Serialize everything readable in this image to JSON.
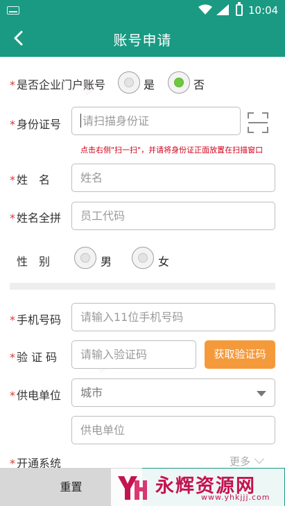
{
  "status_bar": {
    "time": "10:04"
  },
  "header": {
    "title": "账号申请"
  },
  "form": {
    "enterprise_account": {
      "label": "是否企业门户账号",
      "options": [
        "是",
        "否"
      ],
      "selected": "否"
    },
    "id_number": {
      "label": "身份证号",
      "placeholder": "请扫描身份证",
      "hint": "点击右侧\"扫一扫\"，并请将身份证正面放置在扫描窗口"
    },
    "name": {
      "label": "姓　名",
      "placeholder": "姓名"
    },
    "name_pinyin": {
      "label": "姓名全拼",
      "placeholder": "员工代码"
    },
    "gender": {
      "label": "性　别",
      "options": [
        "男",
        "女"
      ]
    },
    "phone": {
      "label": "手机号码",
      "placeholder": "请输入11位手机号码"
    },
    "verify_code": {
      "label": "验 证 码",
      "placeholder": "请输入验证码",
      "button": "获取验证码"
    },
    "power_unit": {
      "label": "供电单位",
      "city_value": "城市",
      "unit_placeholder": "供电单位"
    },
    "open_system": {
      "label": "开通系统",
      "more": "更多"
    }
  },
  "footer": {
    "reset_label": "重置"
  },
  "watermark": {
    "text": "永辉资源网",
    "url": "www.yhkjjj.com"
  },
  "colors": {
    "primary": "#1a9a83",
    "accent_orange": "#f59a3b",
    "required_red": "#d83a3a",
    "radio_checked": "#6cc93f"
  }
}
